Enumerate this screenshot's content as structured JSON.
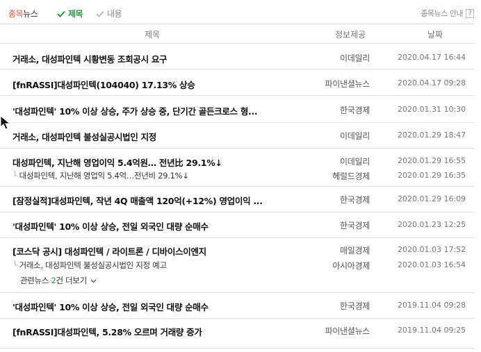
{
  "header": {
    "brand_part1": "종목",
    "brand_part2": "뉴스",
    "filter_title": "제목",
    "filter_content": "내용",
    "help_text": "종목뉴스 안내",
    "help_icon": "?"
  },
  "columns": {
    "title": "제목",
    "source": "정보제공",
    "date": "날짜"
  },
  "rows": [
    {
      "title": "거래소, 대성파인텍 시황변동 조회공시 요구",
      "source": "이데일리",
      "date": "2020.04.17 16:44"
    },
    {
      "title": "[fnRASSI]대성파인텍(104040) 17.13% 상승",
      "source": "파이낸셜뉴스",
      "date": "2020.04.17 09:28"
    },
    {
      "title": "'대성파인텍' 10% 이상 상승, 주가 상승 중, 단기간 골든크로스 형...",
      "source": "한국경제",
      "date": "2020.01.31 10:30"
    },
    {
      "title": "거래소, 대성파인텍 불성실공시법인 지정",
      "source": "이데일리",
      "date": "2020.01.29 18:47"
    },
    {
      "title": "대성파인텍, 지난해 영업이익 5.4억원… 전년比 29.1%↓",
      "source": "이데일리",
      "date": "2020.01.29 16:55",
      "related": [
        {
          "title": "대성파인텍, 지난해 영업익 5.4억…전년비 29.1%↓",
          "source": "헤럴드경제",
          "date": "2020.01.29 16:35"
        }
      ]
    },
    {
      "title": "[잠정실적]대성파인텍, 작년 4Q 매출액 120억(+12%) 영업이익 ...",
      "source": "한국경제",
      "date": "2020.01.29 16:09"
    },
    {
      "title": "'대성파인텍' 10% 이상 상승, 전일 외국인 대량 순매수",
      "source": "한국경제",
      "date": "2020.01.23 12:25"
    },
    {
      "title": "[코스닥 공시] 대성파인텍 / 라이트론 / 디바이스이엔지",
      "source": "매일경제",
      "date": "2020.01.03 17:52",
      "related": [
        {
          "title": "거래소, 대성파인텍 불성실공시법인 지정 예고",
          "source": "아시아경제",
          "date": "2020.01.03 16:54"
        }
      ],
      "more": {
        "prefix": "관련뉴스 ",
        "count": "2",
        "suffix": "건 더보기"
      }
    },
    {
      "title": "'대성파인텍' 10% 이상 상승, 전일 외국인 대량 순매수",
      "source": "한국경제",
      "date": "2019.11.04 09:28"
    },
    {
      "title": "[fnRASSI]대성파인텍, 5.28% 오르며 거래량 증가",
      "source": "파이낸셜뉴스",
      "date": "2019.11.04 09:25"
    }
  ]
}
